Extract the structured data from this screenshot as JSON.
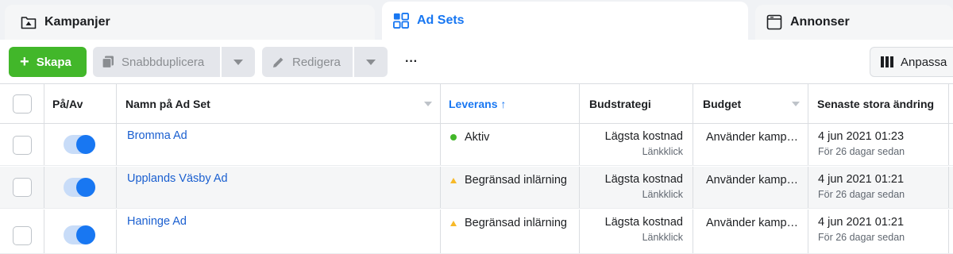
{
  "tabs": [
    {
      "label": "Kampanjer",
      "icon": "campaign-folder-icon",
      "active": false
    },
    {
      "label": "Ad Sets",
      "icon": "ad-sets-grid-icon",
      "active": true
    },
    {
      "label": "Annonser",
      "icon": "ad-window-icon",
      "active": false
    }
  ],
  "toolbar": {
    "create_label": "Skapa",
    "duplicate_label": "Snabbduplicera",
    "edit_label": "Redigera",
    "more_label": "···",
    "customize_label": "Anpassa"
  },
  "table": {
    "headers": {
      "onoff": "På/Av",
      "name": "Namn på Ad Set",
      "delivery": "Leverans ↑",
      "bid_strategy": "Budstrategi",
      "budget": "Budget",
      "last_change": "Senaste stora ändring"
    },
    "rows": [
      {
        "name": "Bromma Ad",
        "delivery": "Aktiv",
        "delivery_status": "active",
        "bid": "Lägsta kostnad",
        "bid_sub": "Länkklick",
        "budget": "Använder kamp…",
        "changed": "4 jun 2021 01:23",
        "changed_sub": "För 26 dagar sedan",
        "enabled": true
      },
      {
        "name": "Upplands Väsby Ad",
        "delivery": "Begränsad inlärning",
        "delivery_status": "warning",
        "bid": "Lägsta kostnad",
        "bid_sub": "Länkklick",
        "budget": "Använder kamp…",
        "changed": "4 jun 2021 01:21",
        "changed_sub": "För 26 dagar sedan",
        "enabled": true
      },
      {
        "name": "Haninge Ad",
        "delivery": "Begränsad inlärning",
        "delivery_status": "warning",
        "bid": "Lägsta kostnad",
        "bid_sub": "Länkklick",
        "budget": "Använder kamp…",
        "changed": "4 jun 2021 01:21",
        "changed_sub": "För 26 dagar sedan",
        "enabled": true
      }
    ]
  },
  "colors": {
    "primary_green": "#42b72a",
    "link_blue": "#1a5fd0",
    "active_blue": "#1877f2",
    "warning_yellow": "#f7b928"
  }
}
